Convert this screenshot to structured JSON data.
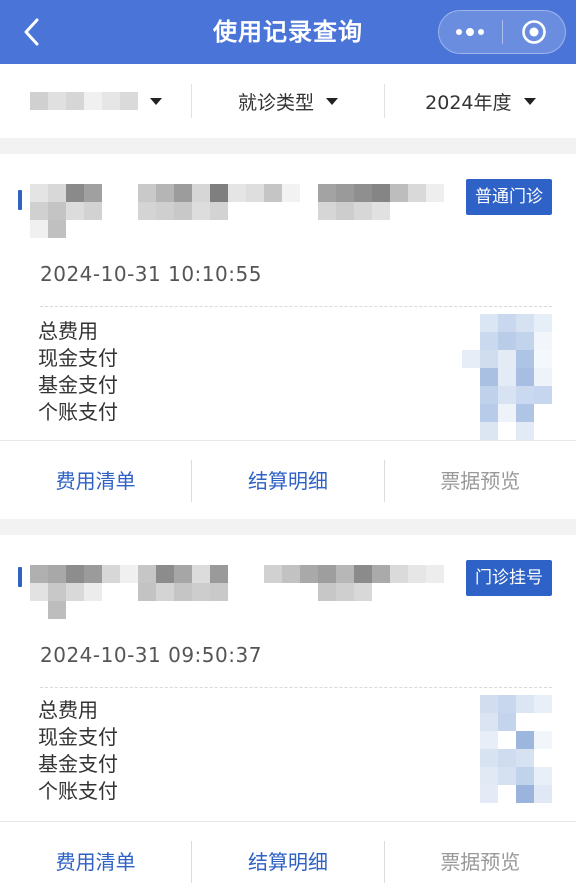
{
  "navbar": {
    "title": "使用记录查询",
    "back_icon": "chevron-left-icon",
    "menu_icon": "more-dots-icon",
    "close_icon": "target-circle-icon",
    "color": "#4a74d8"
  },
  "filters": [
    {
      "label": "",
      "icon": "caret-down-icon"
    },
    {
      "label": "就诊类型",
      "icon": "caret-down-icon"
    },
    {
      "label": "2024年度",
      "icon": "caret-down-icon"
    }
  ],
  "records": [
    {
      "tag": "普通门诊",
      "time": "2024-10-31 10:10:55",
      "fee_labels": [
        "总费用",
        "现金支付",
        "基金支付",
        "个账支付"
      ],
      "actions": [
        {
          "label": "费用清单",
          "enabled": true
        },
        {
          "label": "结算明细",
          "enabled": true
        },
        {
          "label": "票据预览",
          "enabled": false
        }
      ]
    },
    {
      "tag": "门诊挂号",
      "time": "2024-10-31 09:50:37",
      "fee_labels": [
        "总费用",
        "现金支付",
        "基金支付",
        "个账支付"
      ],
      "actions": [
        {
          "label": "费用清单",
          "enabled": true
        },
        {
          "label": "结算明细",
          "enabled": true
        },
        {
          "label": "票据预览",
          "enabled": false
        }
      ]
    }
  ],
  "colors": {
    "accent": "#2f62c6",
    "disabled_text": "#999999",
    "background": "#f2f2f2"
  }
}
